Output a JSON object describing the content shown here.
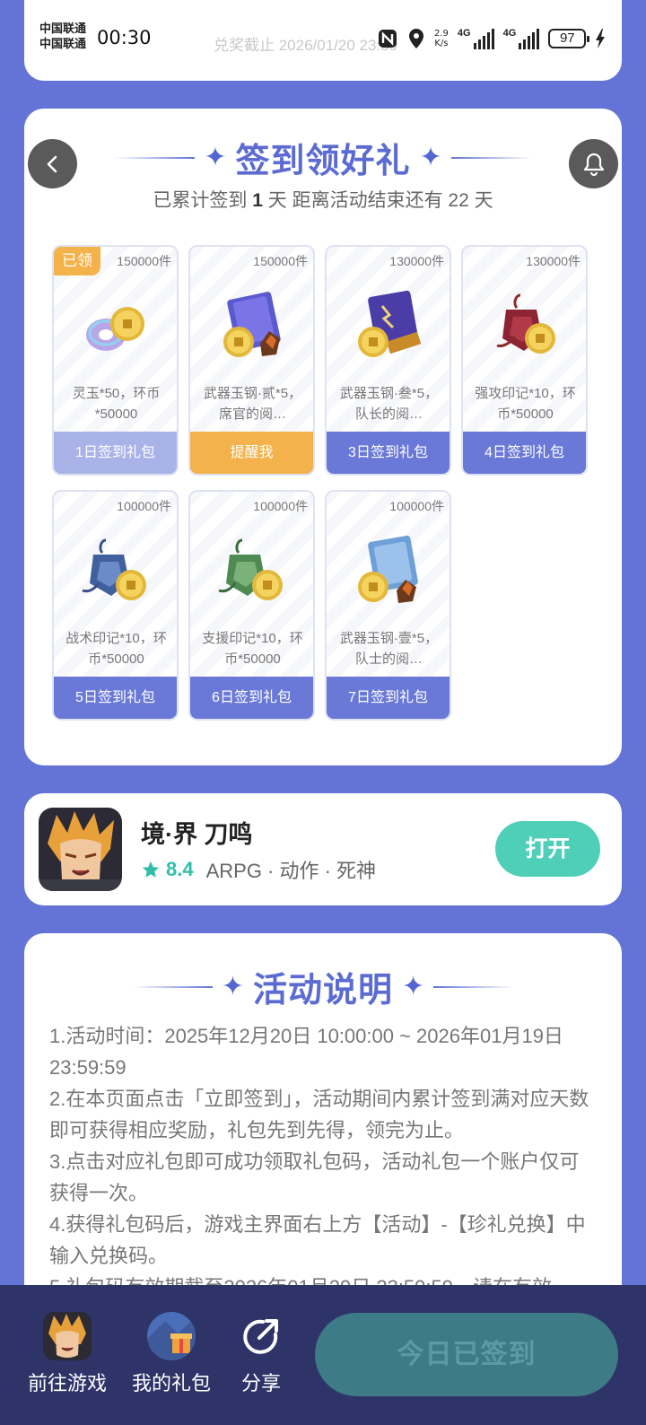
{
  "status_bar": {
    "carrier_1": "中国联通",
    "carrier_2": "中国联通",
    "time": "00:30",
    "net_speed_value": "2.9",
    "net_speed_unit": "K/s",
    "sig_1": "4G",
    "sig_2": "4G",
    "battery": "97"
  },
  "header": {
    "deadline": "兑奖截止 2026/01/20 23:59"
  },
  "signin": {
    "title": "签到领好礼",
    "subtitle_prefix": "已累计签到 ",
    "subtitle_days": "1",
    "subtitle_suffix": " 天  距离活动结束还有 22 天",
    "claimed_label": "已领",
    "gifts": [
      {
        "qty": "150000件",
        "desc": "灵玉*50，环币*50000",
        "button": "1日签到礼包"
      },
      {
        "qty": "150000件",
        "desc": "武器玉钢·贰*5，席官的阅…",
        "button": "提醒我"
      },
      {
        "qty": "130000件",
        "desc": "武器玉钢·叁*5，队长的阅…",
        "button": "3日签到礼包"
      },
      {
        "qty": "130000件",
        "desc": "强攻印记*10，环币*50000",
        "button": "4日签到礼包"
      },
      {
        "qty": "100000件",
        "desc": "战术印记*10，环币*50000",
        "button": "5日签到礼包"
      },
      {
        "qty": "100000件",
        "desc": "支援印记*10，环币*50000",
        "button": "6日签到礼包"
      },
      {
        "qty": "100000件",
        "desc": "武器玉钢·壹*5，队士的阅…",
        "button": "7日签到礼包"
      }
    ]
  },
  "game": {
    "name": "境·界 刀鸣",
    "rating": "8.4",
    "tags": "ARPG · 动作 · 死神",
    "open_label": "打开"
  },
  "rules": {
    "title": "活动说明",
    "lines": [
      "1.活动时间：2025年12月20日 10:00:00 ~ 2026年01月19日 23:59:59",
      "2.在本页面点击「立即签到」，活动期间内累计签到满对应天数即可获得相应奖励，礼包先到先得，领完为止。",
      "3.点击对应礼包即可成功领取礼包码，活动礼包一个账户仅可获得一次。",
      "4.获得礼包码后，游戏主界面右上方【活动】-【珍礼兑换】中输入兑换码。",
      "5.礼包码有效期截至2026年01月29日 23:59:59，请在有效"
    ]
  },
  "bottom_bar": {
    "goto_game": "前往游戏",
    "my_gifts": "我的礼包",
    "share": "分享",
    "checkin": "今日已签到"
  },
  "colors": {
    "background": "#6373d6",
    "accent": "#5b6bd2",
    "gift_button": "#6a79d8",
    "claimed_badge": "#f4b24a",
    "open_button": "#4fcfb8",
    "bottom_bar": "#2e3468"
  }
}
